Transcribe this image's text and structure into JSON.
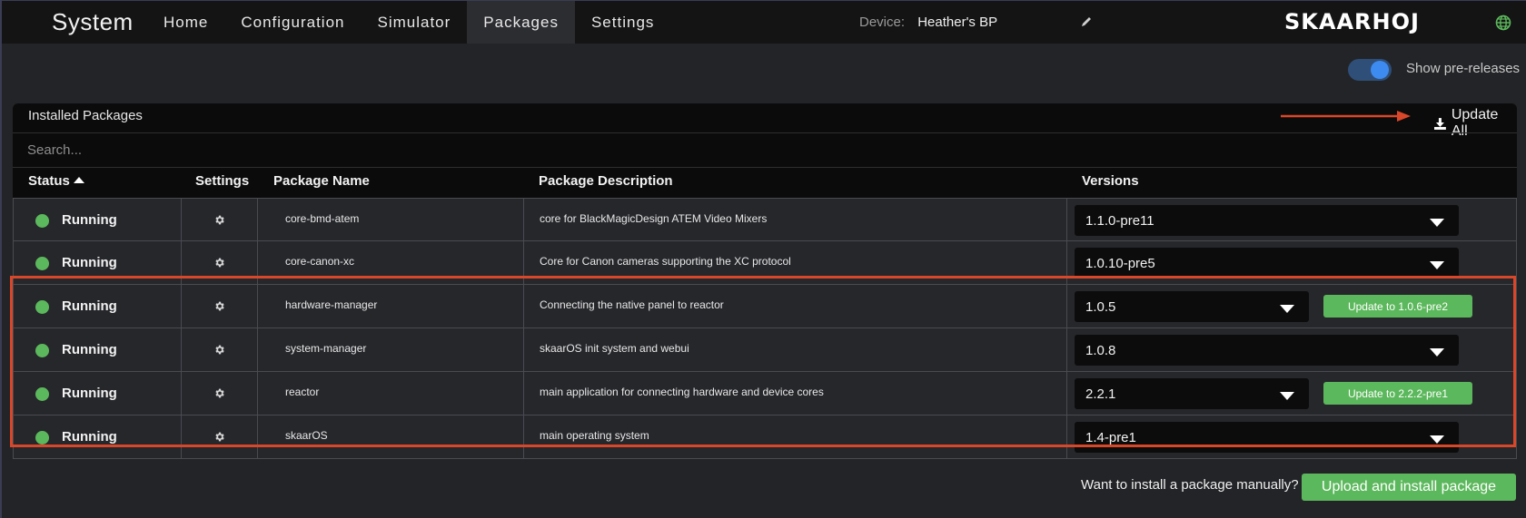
{
  "header": {
    "title": "System",
    "nav": [
      "Home",
      "Configuration",
      "Simulator",
      "Packages",
      "Settings"
    ],
    "active_nav": "Packages",
    "device_label": "Device:",
    "device_name": "Heather's BP",
    "logo": "SKAARHOJ",
    "icons": [
      "pencil-icon",
      "globe-icon"
    ]
  },
  "prerelease_toggle": {
    "label": "Show pre-releases",
    "on": true
  },
  "panel": {
    "title": "Installed Packages",
    "update_all_label": "Update All",
    "search_placeholder": "Search...",
    "columns": [
      "Status",
      "Settings",
      "Package Name",
      "Package Description",
      "Versions"
    ],
    "sort_column": "Status",
    "sort_direction": "ascending"
  },
  "packages": [
    {
      "status": "Running",
      "name": "core-bmd-atem",
      "description": "core for BlackMagicDesign ATEM Video Mixers",
      "version": "1.1.0-pre11",
      "update_label": ""
    },
    {
      "status": "Running",
      "name": "core-canon-xc",
      "description": "Core for Canon cameras supporting the XC protocol",
      "version": "1.0.10-pre5",
      "update_label": ""
    },
    {
      "status": "Running",
      "name": "hardware-manager",
      "description": "Connecting the native panel to reactor",
      "version": "1.0.5",
      "update_label": "Update to 1.0.6-pre2"
    },
    {
      "status": "Running",
      "name": "system-manager",
      "description": "skaarOS init system and webui",
      "version": "1.0.8",
      "update_label": ""
    },
    {
      "status": "Running",
      "name": "reactor",
      "description": "main application for connecting hardware and device cores",
      "version": "2.2.1",
      "update_label": "Update to 2.2.2-pre1"
    },
    {
      "status": "Running",
      "name": "skaarOS",
      "description": "main operating system",
      "version": "1.4-pre1",
      "update_label": ""
    }
  ],
  "footer": {
    "manual_text": "Want to install a package manually?",
    "upload_label": "Upload and install package"
  },
  "colors": {
    "running": "#5cb85c",
    "highlight": "#d9472b",
    "toggle_on": "#3d8bf0"
  }
}
